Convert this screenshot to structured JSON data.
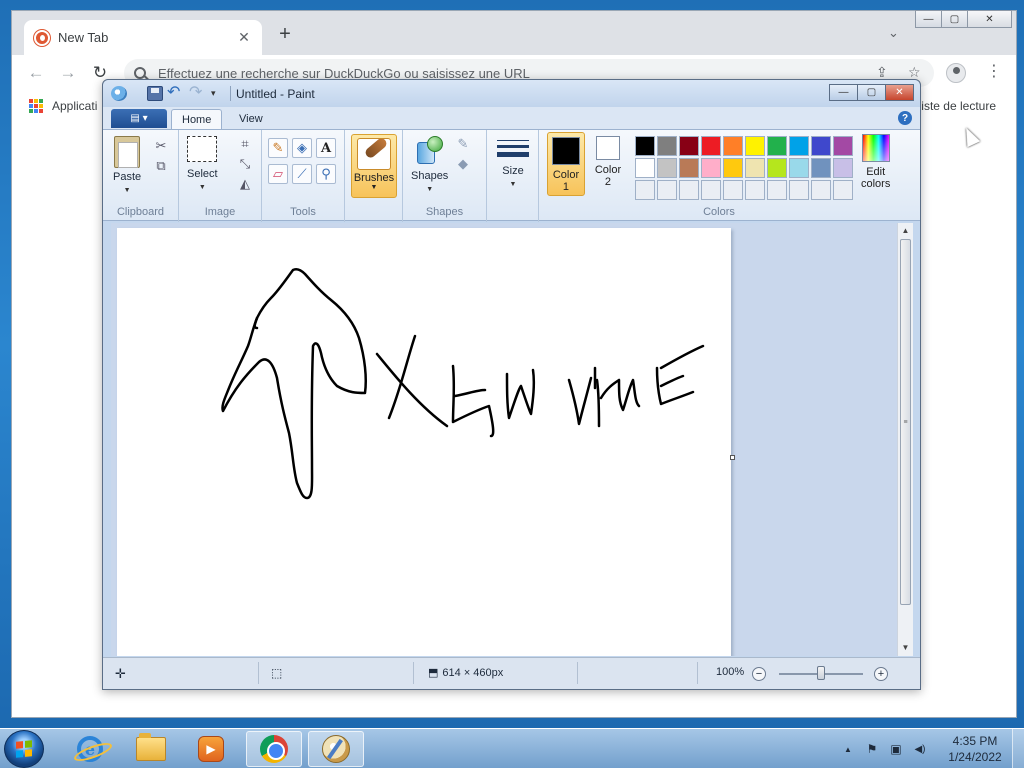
{
  "browser": {
    "tab_title": "New Tab",
    "tab_close": "✕",
    "new_tab": "+",
    "tab_list": "⌄",
    "back": "←",
    "forward": "→",
    "reload": "↻",
    "omnibox_placeholder": "Effectuez une recherche sur DuckDuckGo ou saisissez une URL",
    "share_icon": "⇪",
    "star_icon": "☆",
    "menu_icon": "⋮",
    "bookmarks": {
      "apps": "Applicati",
      "reading_list": "Liste de lecture"
    },
    "window_controls": {
      "minimize": "—",
      "maximize": "▢",
      "close": "✕"
    }
  },
  "paint": {
    "title": "Untitled - Paint",
    "qat": {
      "undo": "↶",
      "redo": "↷",
      "dropdown": "▾"
    },
    "window_controls": {
      "minimize": "—",
      "maximize": "▢",
      "close": "✕"
    },
    "file_menu": "▤ ▾",
    "tabs": [
      "Home",
      "View"
    ],
    "help": "?",
    "groups": {
      "clipboard": {
        "label": "Clipboard",
        "paste": "Paste",
        "cut": "✂",
        "copy": "⧉"
      },
      "image": {
        "label": "Image",
        "select": "Select",
        "crop": "⌗",
        "resize": "⤡",
        "rotate": "◭"
      },
      "tools": {
        "label": "Tools",
        "pencil": "✎",
        "fill": "◈",
        "text": "A",
        "eraser": "▱",
        "picker": "⟋",
        "magnifier": "⚲"
      },
      "brushes": {
        "label": "Brushes"
      },
      "shapes": {
        "label": "Shapes",
        "group_label": "Shapes",
        "outline": "✎",
        "fill": "◆"
      },
      "size": {
        "label": "Size"
      },
      "colors": {
        "label": "Colors",
        "color1": "Color\n1",
        "color2": "Color\n2",
        "edit": "Edit\ncolors"
      }
    },
    "active_color1": "#000000",
    "active_color2": "#ffffff",
    "palette": [
      "#000000",
      "#7f7f7f",
      "#880015",
      "#ed1c24",
      "#ff7f27",
      "#fff200",
      "#22b14c",
      "#00a2e8",
      "#3f48cc",
      "#a349a4",
      "#ffffff",
      "#c3c3c3",
      "#b97a57",
      "#ffaec9",
      "#ffc90e",
      "#efe4b0",
      "#b5e61d",
      "#99d9ea",
      "#7092be",
      "#c8bfe7",
      "#eaeef4",
      "#eaeef4",
      "#eaeef4",
      "#eaeef4",
      "#eaeef4",
      "#eaeef4",
      "#eaeef4",
      "#eaeef4",
      "#eaeef4",
      "#eaeef4"
    ],
    "status": {
      "canvas_size": "614 × 460px",
      "zoom": "100%",
      "zoom_out": "−",
      "zoom_in": "+"
    },
    "scroll": {
      "up": "▲",
      "down": "▼",
      "grip": "≡"
    }
  },
  "taskbar": {
    "clock_time": "4:35 PM",
    "clock_date": "1/24/2022",
    "tray_expand": "▲",
    "tray_flag": "⚑",
    "tray_network": "▣",
    "tray_volume": "◀)"
  }
}
